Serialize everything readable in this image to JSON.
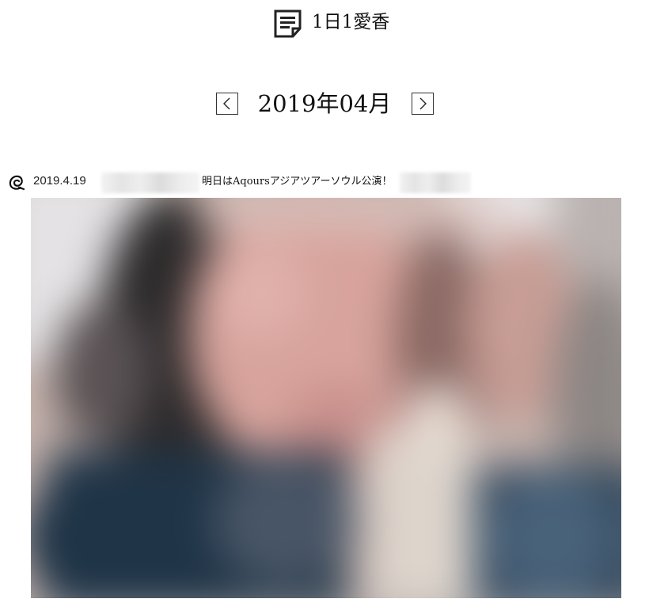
{
  "site": {
    "title": "1日1愛香",
    "icon": "document-icon"
  },
  "month_nav": {
    "label": "2019年04月",
    "prev_icon": "chevron-left-icon",
    "next_icon": "chevron-right-icon"
  },
  "post": {
    "date": "2019.4.19",
    "platform_icon": "instagram-style-logo-icon",
    "caption": "明日はAqoursアジアツアーソウル公演！",
    "photo_icon": "blurred-photo"
  },
  "colors": {
    "text": "#111111",
    "border": "#333333",
    "background": "#ffffff"
  }
}
